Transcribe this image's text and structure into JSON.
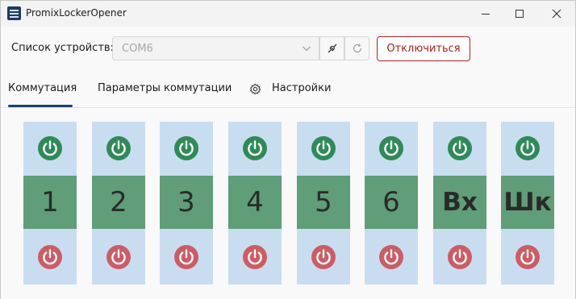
{
  "window": {
    "title": "PromixLockerOpener"
  },
  "devices": {
    "label": "Список устройств:",
    "selected": "COM6",
    "disconnect_label": "Отключиться"
  },
  "tabs": [
    {
      "label": "Коммутация",
      "active": true
    },
    {
      "label": "Параметры коммутации",
      "active": false
    },
    {
      "label": "Настройки",
      "active": false,
      "icon": "gear-icon"
    }
  ],
  "colors": {
    "accent": "#1e3f78",
    "lock_bg": "#c9ddf1",
    "lock_label_bg": "#5f9e78",
    "power_on": "#2e8b57",
    "power_off": "#cd5c64",
    "disconnect": "#b3241c"
  },
  "locks": [
    {
      "label": "1"
    },
    {
      "label": "2"
    },
    {
      "label": "3"
    },
    {
      "label": "4"
    },
    {
      "label": "5"
    },
    {
      "label": "6"
    },
    {
      "label": "Вх"
    },
    {
      "label": "Шк"
    }
  ]
}
